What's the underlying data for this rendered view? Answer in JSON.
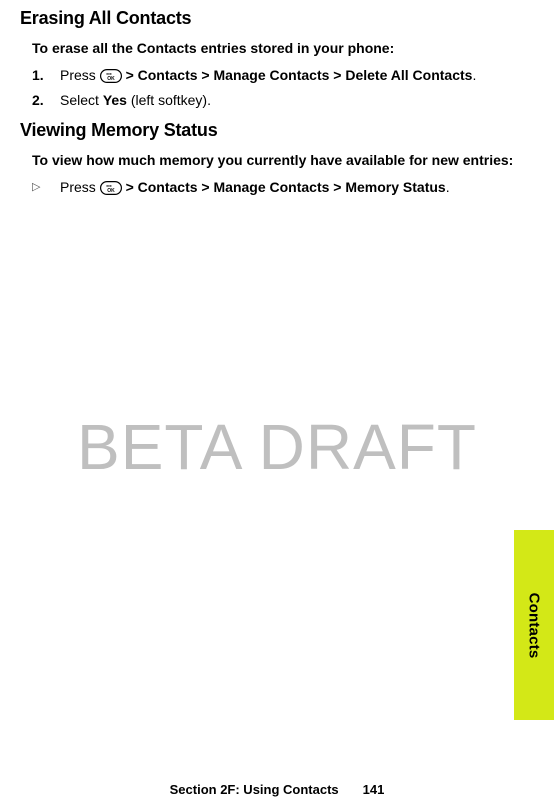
{
  "section1": {
    "heading": "Erasing All Contacts",
    "intro": "To erase all the Contacts entries stored in your phone:",
    "step1": {
      "num": "1.",
      "t1": "Press ",
      "nav": " > Contacts > Manage Contacts > Delete All Contacts",
      "t2": "."
    },
    "step2": {
      "num": "2.",
      "t1": "Select ",
      "yes": "Yes",
      "t2": " (left softkey)."
    }
  },
  "section2": {
    "heading": "Viewing Memory Status",
    "intro": "To view how much memory you currently have available for new entries:",
    "bullet": {
      "mark": "▷",
      "t1": "Press ",
      "nav": " > Contacts > Manage Contacts > Memory Status",
      "t2": "."
    }
  },
  "watermark": "BETA DRAFT",
  "side_tab": "Contacts",
  "footer": {
    "section": "Section 2F: Using Contacts",
    "page": "141"
  }
}
